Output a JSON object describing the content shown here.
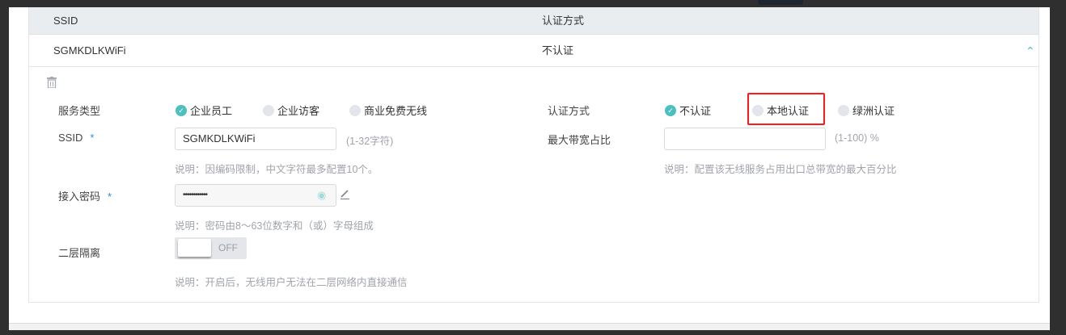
{
  "table": {
    "headers": [
      "SSID",
      "认证方式"
    ],
    "row": {
      "ssid": "SGMKDLKWiFi",
      "auth": "不认证"
    }
  },
  "form": {
    "service_type": {
      "label": "服务类型",
      "options": [
        "企业员工",
        "企业访客",
        "商业免费无线"
      ],
      "selected": "企业员工"
    },
    "ssid": {
      "label": "SSID",
      "required": "*",
      "value": "SGMKDLKWiFi",
      "hint": "(1-32字符)",
      "note": "说明：因编码限制，中文字符最多配置10个。"
    },
    "password": {
      "label": "接入密码",
      "required": "*",
      "value": "••••••••••••",
      "note": "说明：密码由8～63位数字和（或）字母组成"
    },
    "isolation": {
      "label": "二层隔离",
      "state": "OFF",
      "note": "说明：开启后，无线用户无法在二层网络内直接通信"
    },
    "auth": {
      "label": "认证方式",
      "options": [
        "不认证",
        "本地认证",
        "绿洲认证"
      ],
      "selected": "不认证",
      "highlighted": "本地认证",
      "highlight_color": "#ff1a1a"
    },
    "bandwidth": {
      "label": "最大带宽占比",
      "value": "",
      "hint": "(1-100) %",
      "note": "说明：配置该无线服务占用出口总带宽的最大百分比"
    }
  },
  "colors": {
    "accent": "#4cbfbf"
  }
}
